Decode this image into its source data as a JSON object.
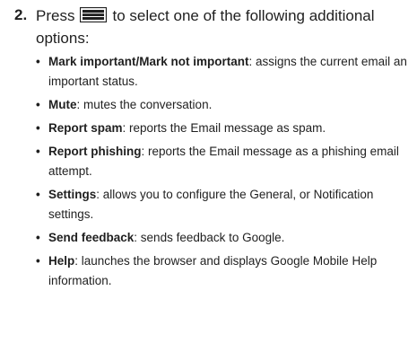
{
  "step": {
    "number": "2.",
    "text_before_icon": "Press",
    "icon": "menu-icon",
    "text_after_icon": "to select one of the following additional options:"
  },
  "options": [
    {
      "term": "Mark important/Mark not important",
      "desc": ": assigns the current email an important status."
    },
    {
      "term": "Mute",
      "desc": ": mutes the conversation."
    },
    {
      "term": "Report spam",
      "desc": ": reports the Email message as spam."
    },
    {
      "term": "Report phishing",
      "desc": ": reports the Email message as a phishing email attempt."
    },
    {
      "term": "Settings",
      "desc": ": allows you to configure the General, or Notification settings."
    },
    {
      "term": "Send feedback",
      "desc": ": sends feedback to Google."
    },
    {
      "term": "Help",
      "desc": ": launches the browser and displays Google Mobile Help information."
    }
  ]
}
